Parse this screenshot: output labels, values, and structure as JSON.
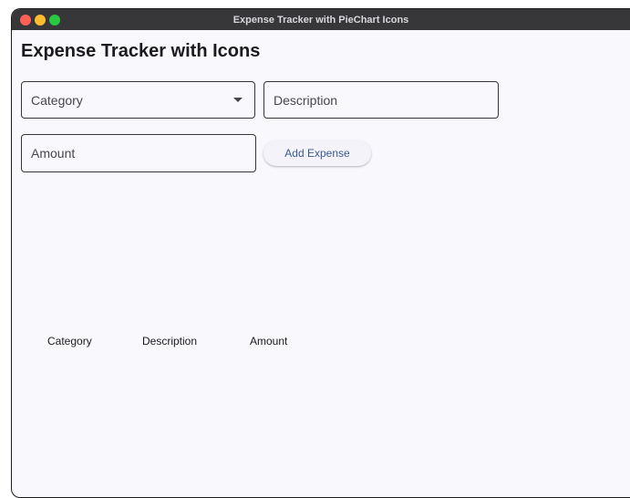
{
  "window": {
    "title": "Expense Tracker with PieChart Icons"
  },
  "page": {
    "heading": "Expense Tracker with Icons"
  },
  "form": {
    "category_placeholder": "Category",
    "description_placeholder": "Description",
    "amount_placeholder": "Amount",
    "add_button_label": "Add Expense"
  },
  "table": {
    "columns": [
      "Category",
      "Description",
      "Amount"
    ],
    "rows": []
  },
  "colors": {
    "background": "#f8f8fd",
    "titlebar": "#37373a",
    "button_text": "#3c5a92",
    "close": "#fe5f57",
    "minimize": "#febc2e",
    "maximize": "#28c840"
  }
}
